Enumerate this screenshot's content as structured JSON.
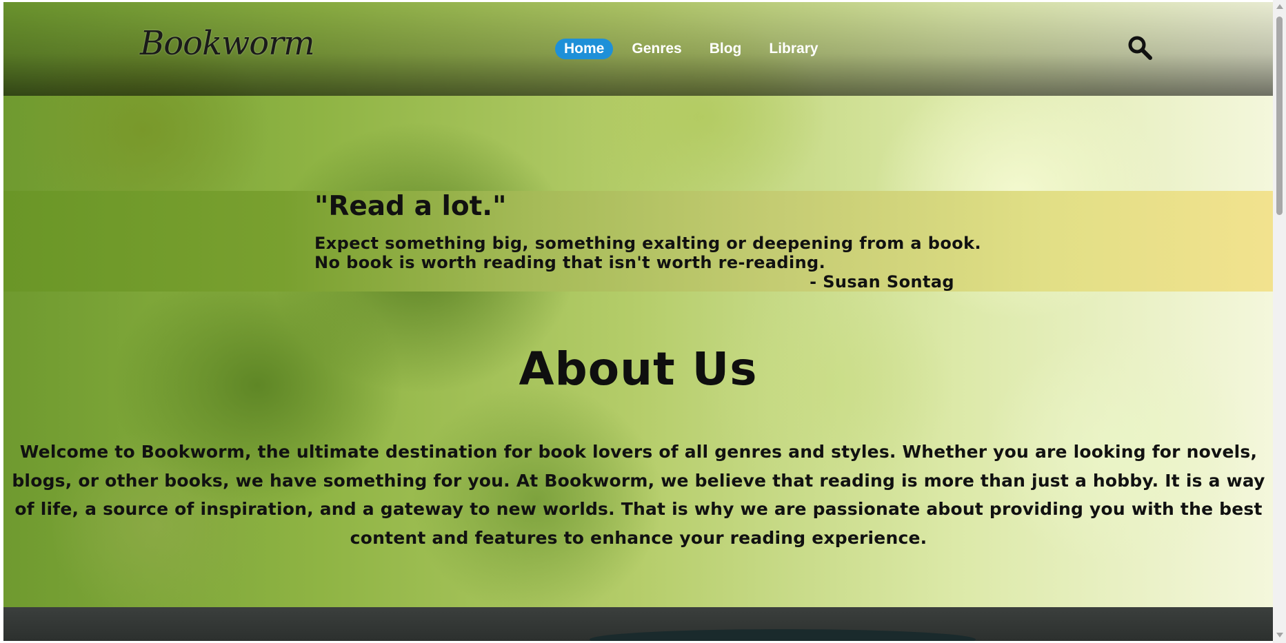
{
  "header": {
    "logo": "Bookworm",
    "nav": [
      {
        "label": "Home",
        "active": true
      },
      {
        "label": "Genres",
        "active": false
      },
      {
        "label": "Blog",
        "active": false
      },
      {
        "label": "Library",
        "active": false
      }
    ],
    "search_icon": "search-icon"
  },
  "quote": {
    "title": "\"Read a lot.\"",
    "line1": "Expect something big, something exalting or deepening from a book.",
    "line2": "No book is worth reading that isn't worth re-reading.",
    "author": "- Susan Sontag"
  },
  "about": {
    "title": "About Us",
    "text": "Welcome to Bookworm, the ultimate destination for book lovers of all genres and styles. Whether you are looking for novels, blogs, or other books, we have something for you. At Bookworm, we believe that reading is more than just a hobby. It is a way of life, a source of inspiration, and a gateway to new worlds. That is why we are passionate about providing you with the best content and features to enhance your reading experience."
  },
  "colors": {
    "nav_active": "#1e90d8",
    "nav_text": "#ffffff",
    "quote_band_start": "#6a9627",
    "quote_band_end": "#f2e28e"
  }
}
